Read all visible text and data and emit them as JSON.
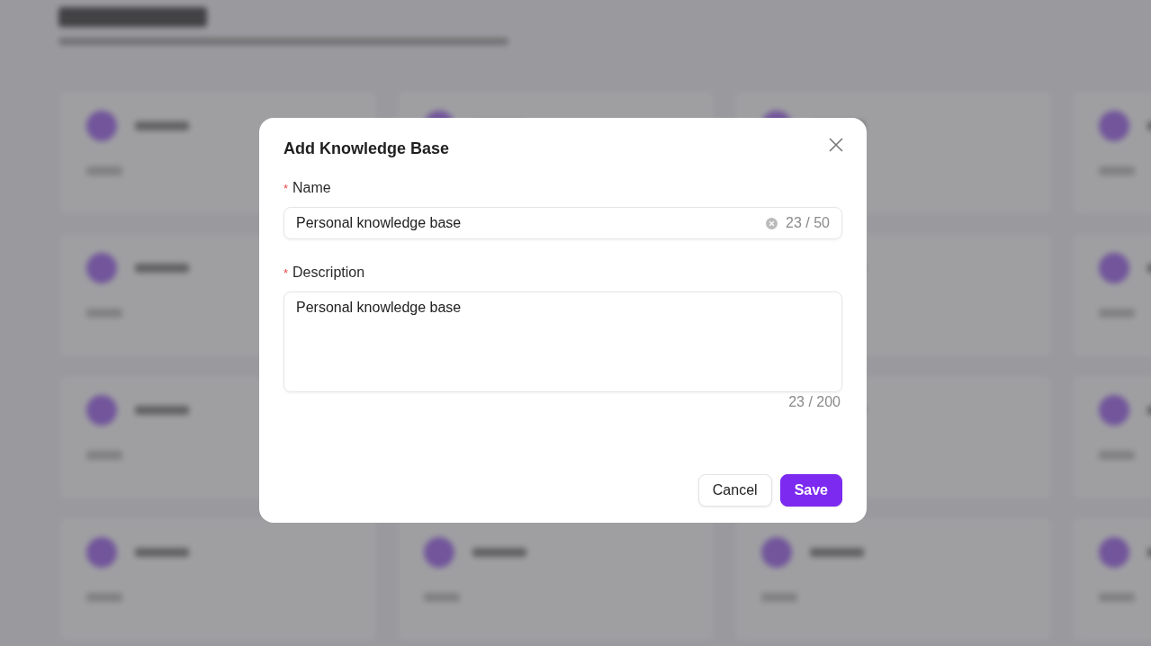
{
  "dialog": {
    "title": "Add Knowledge Base",
    "fields": [
      {
        "kind": "input",
        "marker": "*",
        "label": "Name",
        "value": "Personal knowledge base",
        "count": "23 / 50"
      },
      {
        "kind": "textarea",
        "marker": "*",
        "label": "Description",
        "value": "Personal knowledge base",
        "count": "23 / 200"
      }
    ],
    "buttons": [
      {
        "kind": "secondary",
        "label": "Cancel"
      },
      {
        "kind": "primary",
        "label": "Save"
      }
    ]
  }
}
